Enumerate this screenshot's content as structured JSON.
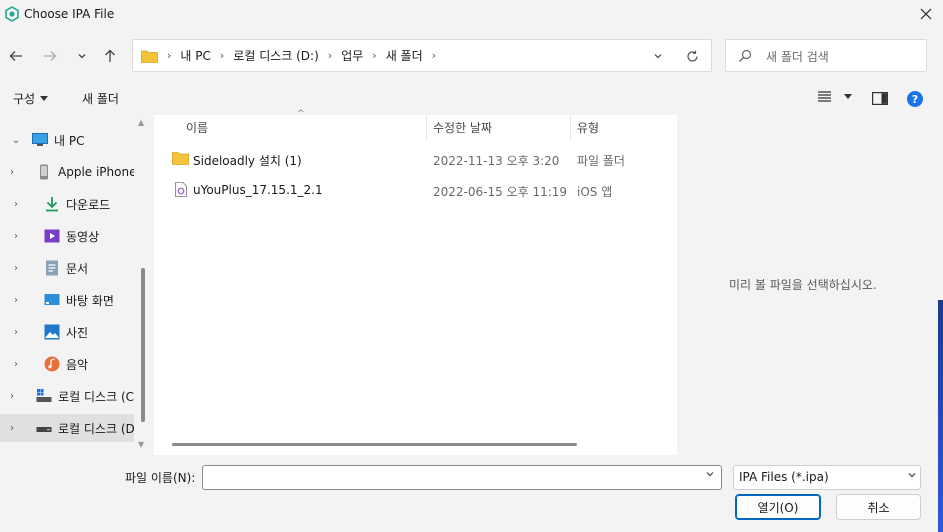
{
  "window": {
    "title": "Choose IPA File"
  },
  "nav": {
    "breadcrumb": [
      "내 PC",
      "로컬 디스크 (D:)",
      "업무",
      "새 폴더"
    ],
    "search_placeholder": "새 폴더 검색"
  },
  "command_bar": {
    "organize": "구성",
    "new_folder": "새 폴더"
  },
  "sidebar": {
    "items": [
      {
        "label": "내 PC",
        "icon": "pc-icon",
        "expanded": true
      },
      {
        "label": "Apple iPhone",
        "icon": "phone-icon"
      },
      {
        "label": "다운로드",
        "icon": "download-icon"
      },
      {
        "label": "동영상",
        "icon": "video-icon"
      },
      {
        "label": "문서",
        "icon": "document-icon"
      },
      {
        "label": "바탕 화면",
        "icon": "desktop-icon"
      },
      {
        "label": "사진",
        "icon": "picture-icon"
      },
      {
        "label": "음악",
        "icon": "music-icon"
      },
      {
        "label": "로컬 디스크 (C",
        "icon": "drive-c-icon"
      },
      {
        "label": "로컬 디스크 (D",
        "icon": "drive-d-icon",
        "selected": true
      }
    ]
  },
  "columns": {
    "name": "이름",
    "modified": "수정한 날짜",
    "type": "유형"
  },
  "files": [
    {
      "name": "Sideloadly 설치 (1)",
      "date": "2022-11-13 오후 3:20",
      "type": "파일 폴더",
      "icon": "folder-icon"
    },
    {
      "name": "uYouPlus_17.15.1_2.1",
      "date": "2022-06-15 오후 11:19",
      "type": "iOS 앱",
      "icon": "ipa-file-icon"
    }
  ],
  "preview": {
    "empty_text": "미리 볼 파일을 선택하십시오."
  },
  "bottom": {
    "filename_label": "파일 이름(N):",
    "filename_value": "",
    "filter_value": "IPA Files (*.ipa)",
    "open_label": "열기(O)",
    "cancel_label": "취소"
  },
  "colors": {
    "accent": "#0067c0",
    "folder": "#f4c23d",
    "window_bg": "#f3f3f3"
  }
}
